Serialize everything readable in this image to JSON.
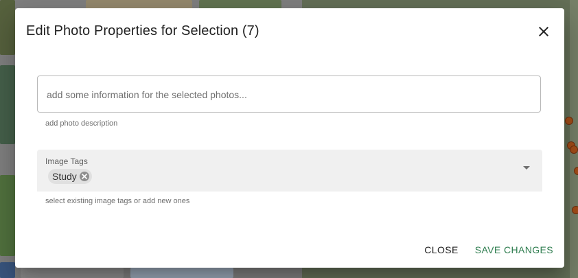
{
  "dialog": {
    "title": "Edit Photo Properties for Selection (7)",
    "close_icon": "close-icon"
  },
  "description": {
    "placeholder": "add some information for the selected photos...",
    "value": "",
    "hint": "add photo description"
  },
  "tags": {
    "label": "Image Tags",
    "chips": [
      "Study"
    ],
    "hint": "select existing image tags or add new ones",
    "dropdown_icon": "caret-down-icon"
  },
  "actions": {
    "close_label": "CLOSE",
    "save_label": "SAVE CHANGES"
  },
  "colors": {
    "accent": "#2e7d4f",
    "map_marker": "#b4551c"
  }
}
